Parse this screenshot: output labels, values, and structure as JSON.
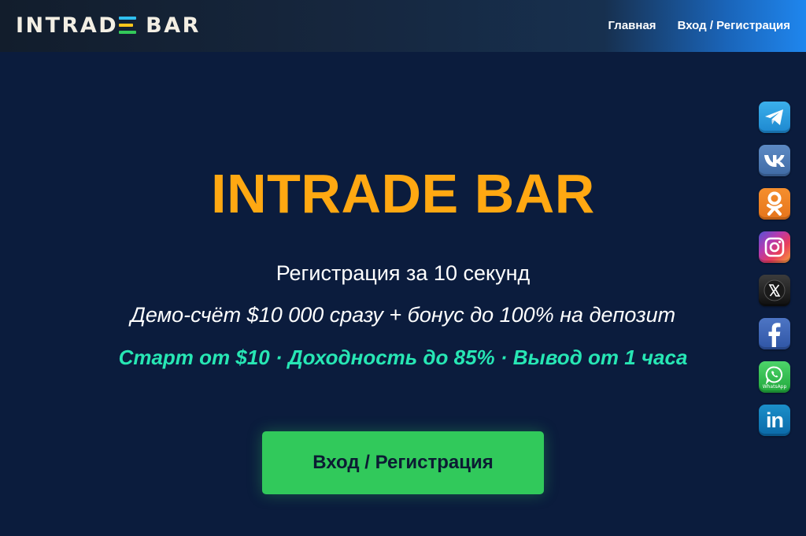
{
  "header": {
    "logo_left": "INTRAD",
    "logo_right": "BAR",
    "nav": [
      {
        "label": "Главная"
      },
      {
        "label": "Вход / Регистрация"
      }
    ]
  },
  "hero": {
    "title": "INTRADE BAR",
    "subtitle": "Регистрация за 10 секунд",
    "demo_line": "Демо-счёт $10 000 сразу + бонус до 100% на депозит",
    "features": "Старт от $10 · Доходность до 85% · Вывод от 1 часа",
    "cta_label": "Вход / Регистрация"
  },
  "social": {
    "items": [
      "telegram-icon",
      "vk-icon",
      "odnoklassniki-icon",
      "instagram-icon",
      "x-icon",
      "facebook-icon",
      "whatsapp-icon",
      "linkedin-icon"
    ],
    "whatsapp_caption": "WhatsApp",
    "linkedin_text": "in"
  },
  "colors": {
    "background": "#0b1c3d",
    "title": "#ffa812",
    "features": "#27e6b4",
    "cta": "#31c95b",
    "cta_text": "#0c1c33"
  }
}
